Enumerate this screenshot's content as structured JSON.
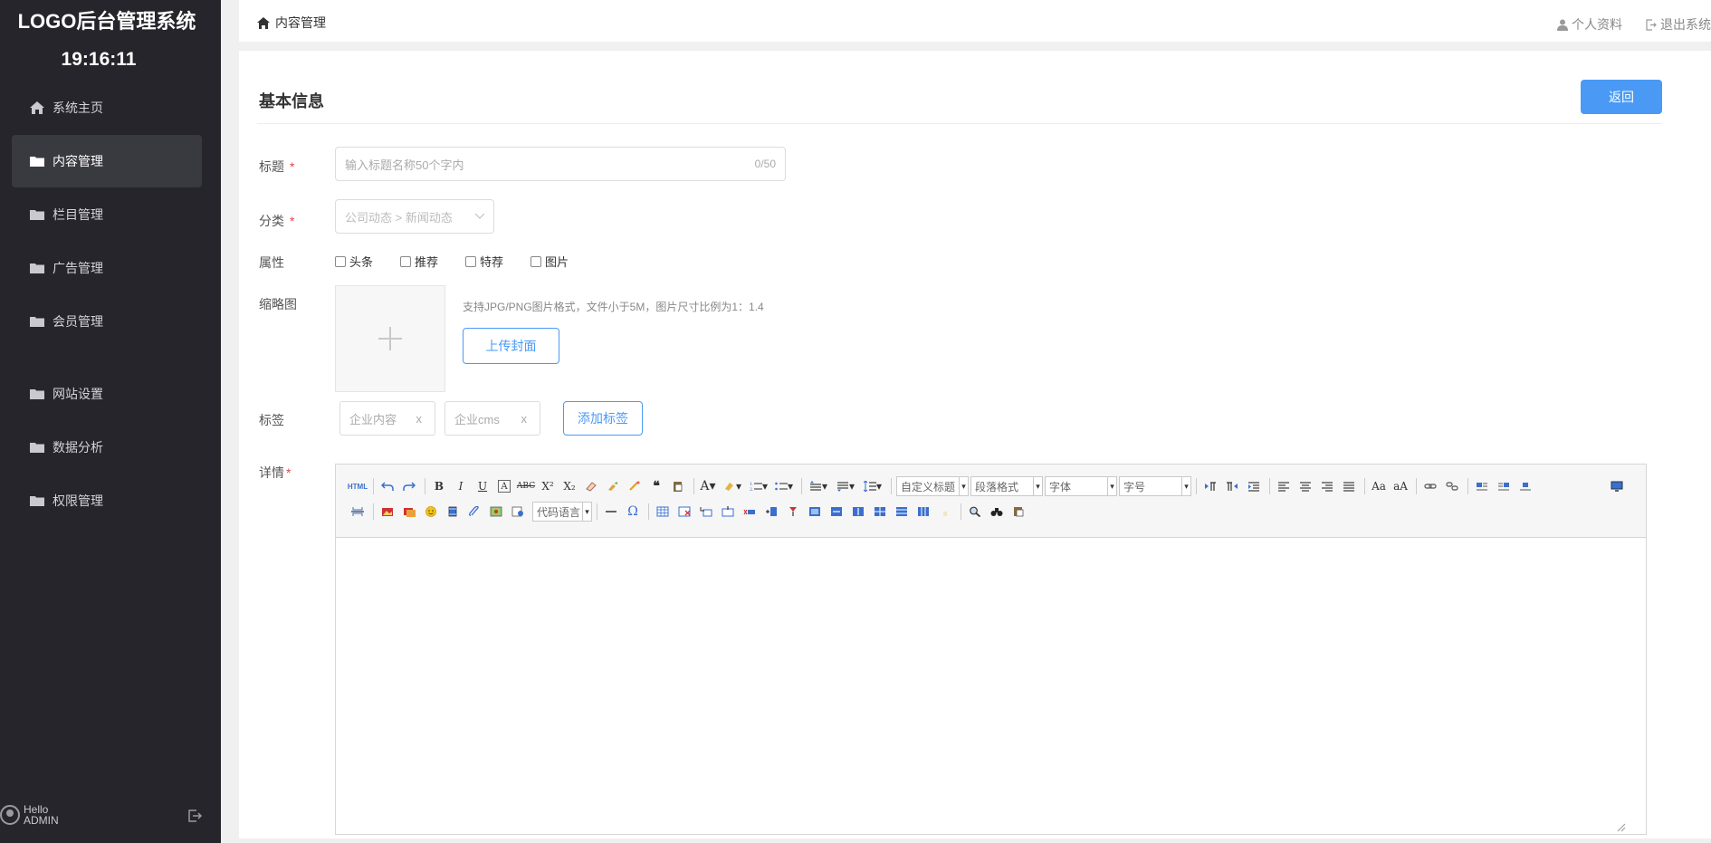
{
  "sidebar": {
    "logo": "LOGO后台管理系统",
    "clock": "19:16:11",
    "items": [
      {
        "label": "系统主页",
        "icon": "home-icon"
      },
      {
        "label": "内容管理",
        "icon": "folder-icon",
        "active": true
      },
      {
        "label": "栏目管理",
        "icon": "folder-icon"
      },
      {
        "label": "广告管理",
        "icon": "folder-icon"
      },
      {
        "label": "会员管理",
        "icon": "folder-icon"
      },
      {
        "label": "网站设置",
        "icon": "folder-icon"
      },
      {
        "label": "数据分析",
        "icon": "folder-icon"
      },
      {
        "label": "权限管理",
        "icon": "folder-icon"
      }
    ],
    "user": {
      "greeting": "Hello",
      "name": "ADMIN"
    }
  },
  "topbar": {
    "breadcrumb": "内容管理",
    "profile": "个人资料",
    "logout": "退出系统"
  },
  "form": {
    "section_title": "基本信息",
    "back": "返回",
    "title_label": "标题",
    "title_placeholder": "输入标题名称50个字内",
    "title_count": "0/50",
    "category_label": "分类",
    "category_value": "公司动态 > 新闻动态",
    "attr_label": "属性",
    "attrs": [
      "头条",
      "推荐",
      "特荐",
      "图片"
    ],
    "thumb_label": "缩略图",
    "thumb_hint": "支持JPG/PNG图片格式，文件小于5M，图片尺寸比例为1：1.4",
    "upload": "上传封面",
    "tags_label": "标签",
    "tags": [
      "企业内容",
      "企业cms"
    ],
    "tag_remove": "x",
    "add_tag": "添加标签",
    "detail_label": "详情",
    "required_mark": "*"
  },
  "editor": {
    "html_btn": "HTML",
    "selects": {
      "heading": "自定义标题",
      "paragraph": "段落格式",
      "font": "字体",
      "size": "字号",
      "code": "代码语言"
    },
    "colors": {
      "accent": "#4a9af5",
      "sidebar": "#25252b",
      "sidebar_active": "#393940",
      "required": "#e54545"
    }
  }
}
